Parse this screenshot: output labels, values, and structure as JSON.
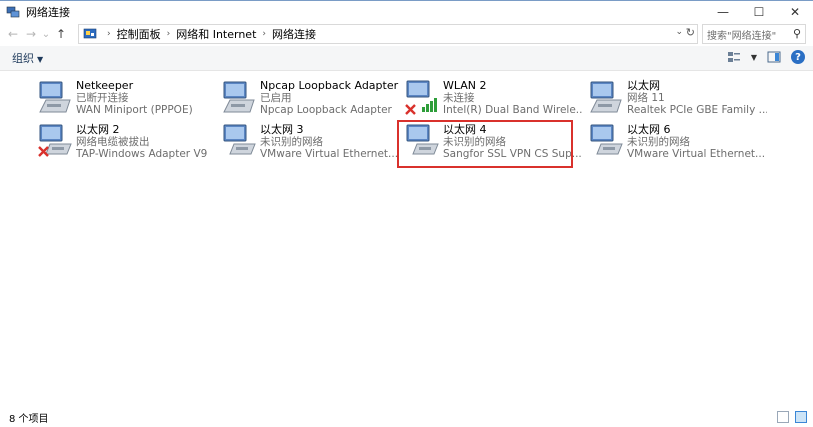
{
  "window": {
    "title": "网络连接",
    "controls": [
      "—",
      "☐",
      "✕"
    ]
  },
  "nav": {
    "back": "←",
    "forward": "→",
    "recent": "⌄",
    "up": "↑"
  },
  "address": {
    "segments": [
      "控制面板",
      "网络和 Internet",
      "网络连接"
    ],
    "separator": "›"
  },
  "search": {
    "placeholder": "搜索\"网络连接\""
  },
  "toolbar": {
    "organize_label": "组织"
  },
  "items": [
    {
      "name": "Netkeeper",
      "status": "已断开连接",
      "device": "WAN Miniport (PPPOE)"
    },
    {
      "name": "Npcap Loopback Adapter",
      "status": "已启用",
      "device": "Npcap Loopback Adapter"
    },
    {
      "name": "WLAN 2",
      "status": "未连接",
      "device": "Intel(R) Dual Band Wirele..."
    },
    {
      "name": "以太网",
      "status": "网络 11",
      "device": "Realtek PCIe GBE Family ..."
    },
    {
      "name": "以太网 2",
      "status": "网络电缆被拔出",
      "device": "TAP-Windows Adapter V9"
    },
    {
      "name": "以太网 3",
      "status": "未识别的网络",
      "device": "VMware Virtual Ethernet..."
    },
    {
      "name": "以太网 4",
      "status": "未识别的网络",
      "device": "Sangfor SSL VPN CS Sup..."
    },
    {
      "name": "以太网 6",
      "status": "未识别的网络",
      "device": "VMware Virtual Ethernet..."
    }
  ],
  "statusbar": {
    "count": "8 个项目"
  },
  "colors": {
    "highlight": "#d9312c",
    "accent": "#2a6fc4",
    "error": "#d9312c",
    "wifi_bars": "#2e9e3a"
  }
}
